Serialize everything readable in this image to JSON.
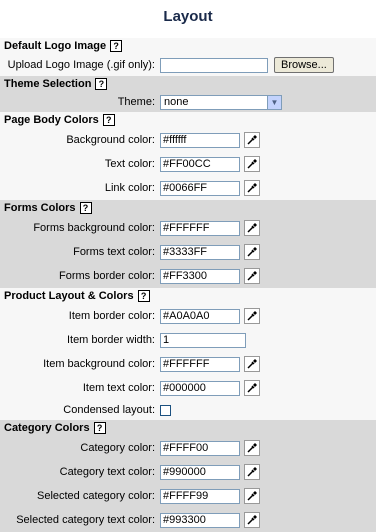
{
  "page": {
    "title": "Layout"
  },
  "sections": {
    "logo": {
      "title": "Default Logo Image",
      "upload_label": "Upload Logo Image (.gif only):",
      "upload_value": "",
      "browse_label": "Browse..."
    },
    "theme": {
      "title": "Theme Selection",
      "theme_label": "Theme:",
      "theme_value": "none"
    },
    "page_body": {
      "title": "Page Body Colors",
      "bg_label": "Background color:",
      "bg_value": "#ffffff",
      "text_label": "Text color:",
      "text_value": "#FF00CC",
      "link_label": "Link color:",
      "link_value": "#0066FF"
    },
    "forms": {
      "title": "Forms Colors",
      "bg_label": "Forms background color:",
      "bg_value": "#FFFFFF",
      "text_label": "Forms text color:",
      "text_value": "#3333FF",
      "border_label": "Forms border color:",
      "border_value": "#FF3300"
    },
    "product": {
      "title": "Product Layout & Colors",
      "border_color_label": "Item border color:",
      "border_color_value": "#A0A0A0",
      "border_width_label": "Item border width:",
      "border_width_value": "1",
      "bg_label": "Item background color:",
      "bg_value": "#FFFFFF",
      "text_label": "Item text color:",
      "text_value": "#000000",
      "condensed_label": "Condensed layout:"
    },
    "category": {
      "title": "Category Colors",
      "color_label": "Category color:",
      "color_value": "#FFFF00",
      "text_label": "Category text color:",
      "text_value": "#990000",
      "sel_label": "Selected category color:",
      "sel_value": "#FFFF99",
      "sel_text_label": "Selected category text color:",
      "sel_text_value": "#993300"
    }
  },
  "help_glyph": "?",
  "icons": {
    "picker": "eyedropper-icon",
    "help": "help-icon"
  },
  "colors": {
    "section_gray": "#d9d9d9",
    "title": "#1a2a4a"
  }
}
